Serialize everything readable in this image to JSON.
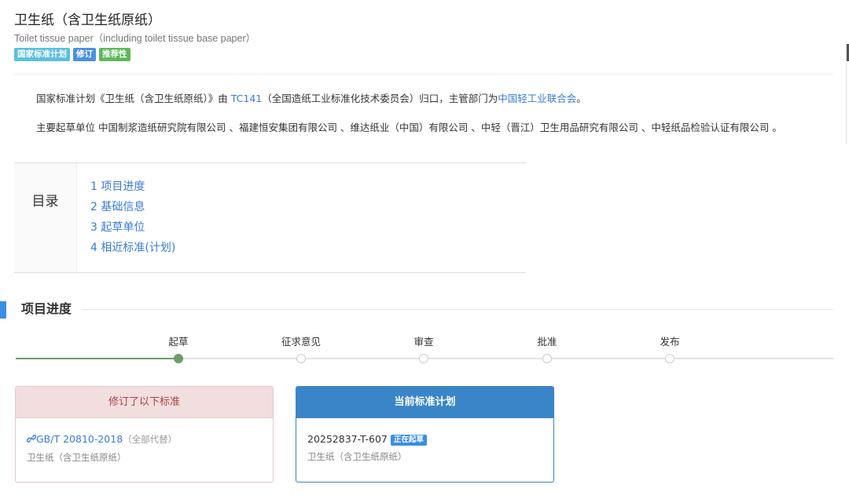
{
  "header": {
    "title": "卫生纸（含卫生纸原纸）",
    "subtitle": "Toilet tissue paper（including toilet tissue base paper）",
    "tags": [
      "国家标准计划",
      "修订",
      "推荐性"
    ]
  },
  "description": {
    "line1_prefix": "国家标准计划《卫生纸（含卫生纸原纸）》由 ",
    "tc_link": "TC141",
    "line1_mid": "（全国造纸工业标准化技术委员会）归口，主管部门为",
    "dept_link": "中国轻工业联合会",
    "line1_suffix": "。",
    "line2": "主要起草单位 中国制浆造纸研究院有限公司 、福建恒安集团有限公司 、维达纸业（中国）有限公司 、中轻（晋江）卫生用品研究有限公司 、中轻纸品检验认证有限公司 。"
  },
  "toc": {
    "title": "目录",
    "items": [
      "1  项目进度",
      "2  基础信息",
      "3  起草单位",
      "4  相近标准(计划)"
    ]
  },
  "progress_section": {
    "title": "项目进度",
    "steps": [
      {
        "label": "起草",
        "active": true
      },
      {
        "label": "征求意见",
        "active": false
      },
      {
        "label": "审查",
        "active": false
      },
      {
        "label": "批准",
        "active": false
      },
      {
        "label": "发布",
        "active": false
      }
    ],
    "progress_fraction": 0.2
  },
  "cards": {
    "revised": {
      "header": "修订了以下标准",
      "std_link": "GB/T 20810-2018",
      "note": "（全部代替）",
      "name": "卫生纸（含卫生纸原纸）"
    },
    "current": {
      "header": "当前标准计划",
      "plan_no": "20252837-T-607",
      "status": "正在起草",
      "name": "卫生纸（含卫生纸原纸）"
    }
  },
  "icons": {
    "link": "link-icon"
  },
  "colors": {
    "accent": "#3a7bd5",
    "section_bar": "#3a8ee6",
    "progress_active": "#6a9c6a",
    "revised_header_bg": "#f2dede",
    "revised_header_text": "#a94442",
    "current_header_bg": "#3a85c8"
  }
}
